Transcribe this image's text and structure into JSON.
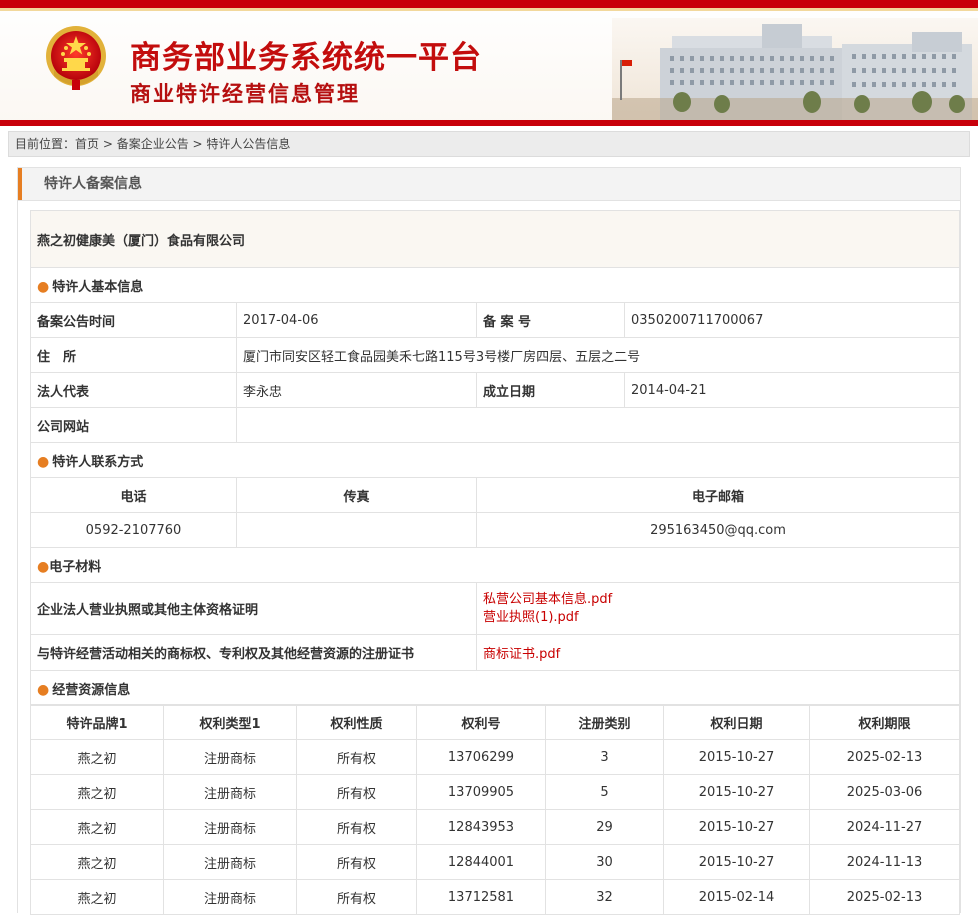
{
  "header": {
    "title": "商务部业务系统统一平台",
    "subtitle": "商业特许经营信息管理",
    "brand_red": "#c8000b",
    "accent_orange": "#e67e22"
  },
  "breadcrumb": {
    "prefix": "目前位置：",
    "items": [
      "首页",
      "备案企业公告",
      "特许人公告信息"
    ],
    "sep": " > "
  },
  "panel": {
    "title": "特许人备案信息"
  },
  "company": {
    "name": "燕之初健康美（厦门）食品有限公司"
  },
  "basic": {
    "section": "特许人基本信息",
    "announce_label": "备案公告时间",
    "announce_value": "2017-04-06",
    "record_no_label": "备 案 号",
    "record_no_value": "0350200711700067",
    "address_label": "住　所",
    "address_value": "厦门市同安区轻工食品园美禾七路115号3号楼厂房四层、五层之二号",
    "legal_label": "法人代表",
    "legal_value": "李永忠",
    "found_label": "成立日期",
    "found_value": "2014-04-21",
    "site_label": "公司网站",
    "site_value": ""
  },
  "contact": {
    "section": "特许人联系方式",
    "phone_label": "电话",
    "fax_label": "传真",
    "email_label": "电子邮箱",
    "phone_value": "0592-2107760",
    "fax_value": "",
    "email_value": "295163450@qq.com"
  },
  "materials": {
    "section": "电子材料",
    "rows": [
      {
        "label": "企业法人营业执照或其他主体资格证明",
        "files": [
          "私营公司基本信息.pdf",
          "营业执照(1).pdf"
        ]
      },
      {
        "label": "与特许经营活动相关的商标权、专利权及其他经营资源的注册证书",
        "files": [
          "商标证书.pdf"
        ]
      }
    ]
  },
  "resources": {
    "section": "经营资源信息",
    "headers": [
      "特许品牌1",
      "权利类型1",
      "权利性质",
      "权利号",
      "注册类别",
      "权利日期",
      "权利期限"
    ],
    "rows": [
      [
        "燕之初",
        "注册商标",
        "所有权",
        "13706299",
        "3",
        "2015-10-27",
        "2025-02-13"
      ],
      [
        "燕之初",
        "注册商标",
        "所有权",
        "13709905",
        "5",
        "2015-10-27",
        "2025-03-06"
      ],
      [
        "燕之初",
        "注册商标",
        "所有权",
        "12843953",
        "29",
        "2015-10-27",
        "2024-11-27"
      ],
      [
        "燕之初",
        "注册商标",
        "所有权",
        "12844001",
        "30",
        "2015-10-27",
        "2024-11-13"
      ],
      [
        "燕之初",
        "注册商标",
        "所有权",
        "13712581",
        "32",
        "2015-02-14",
        "2025-02-13"
      ]
    ]
  }
}
